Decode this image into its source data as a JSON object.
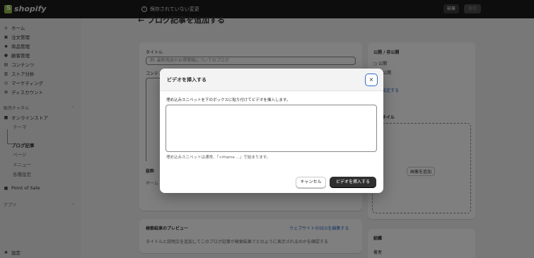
{
  "topbar": {
    "brand": "shopify",
    "unsaved_text": "保存されていない変更",
    "discard_label": "破棄",
    "save_label": "保存"
  },
  "sidebar": {
    "items": [
      {
        "label": "ホーム",
        "icon": "home-icon"
      },
      {
        "label": "注文管理",
        "icon": "inbox-icon"
      },
      {
        "label": "商品管理",
        "icon": "tag-icon"
      },
      {
        "label": "顧客管理",
        "icon": "person-icon"
      },
      {
        "label": "コンテンツ",
        "icon": "content-icon"
      },
      {
        "label": "ストア分析",
        "icon": "bar-chart-icon"
      },
      {
        "label": "マーケティング",
        "icon": "target-icon"
      },
      {
        "label": "ディスカウント",
        "icon": "discount-icon"
      }
    ],
    "sales_channels_heading": "販売チャネル",
    "online_store_label": "オンラインストア",
    "sub_items": [
      "テーマ",
      "ブログ記事",
      "ページ",
      "メニュー",
      "各種設定"
    ],
    "point_of_sale_label": "Point of Sale",
    "apps_heading": "アプリ",
    "settings_label": "設定"
  },
  "main": {
    "page_title": "← ブログ記事を追加する",
    "title_label": "タイトル",
    "title_placeholder": "例: 最新商品やお得情報についてのブログ",
    "content_label": "コンテンツ",
    "excerpt_heading": "抜粋",
    "excerpt_text": "ホーム",
    "seo_heading": "検索結果のプレビュー",
    "seo_edit_link": "ウェブサイトのSEOを編集する",
    "seo_desc": "タイトルと説明文を追加してこのブログ記事が検索結果でどのように表示されるのかを確認する"
  },
  "right": {
    "visibility_heading": "公開 / 非公開",
    "visible_option": "公開",
    "hidden_option": "非公開",
    "set_date_link": "日を設定する",
    "thumbnail_heading": "サムネイル",
    "add_image_label": "画像を追加",
    "organize_heading": "組織",
    "author_label": "著者"
  },
  "modal": {
    "title": "ビデオを挿入する",
    "close_label": "×",
    "description": "埋め込みスニペットを下のボックスに貼り付けてビデオを挿入します。",
    "textarea_value": "",
    "help_text": "埋め込みスニペットは通常、「<iframe ...」で始まります。",
    "cancel_label": "キャンセル",
    "insert_label": "ビデオを挿入する"
  },
  "colors": {
    "topbar": "#1a1a1a",
    "overlay": "rgba(0,0,0,0.5)",
    "primary_button": "#303030",
    "focus_ring": "#2c6ecb"
  }
}
